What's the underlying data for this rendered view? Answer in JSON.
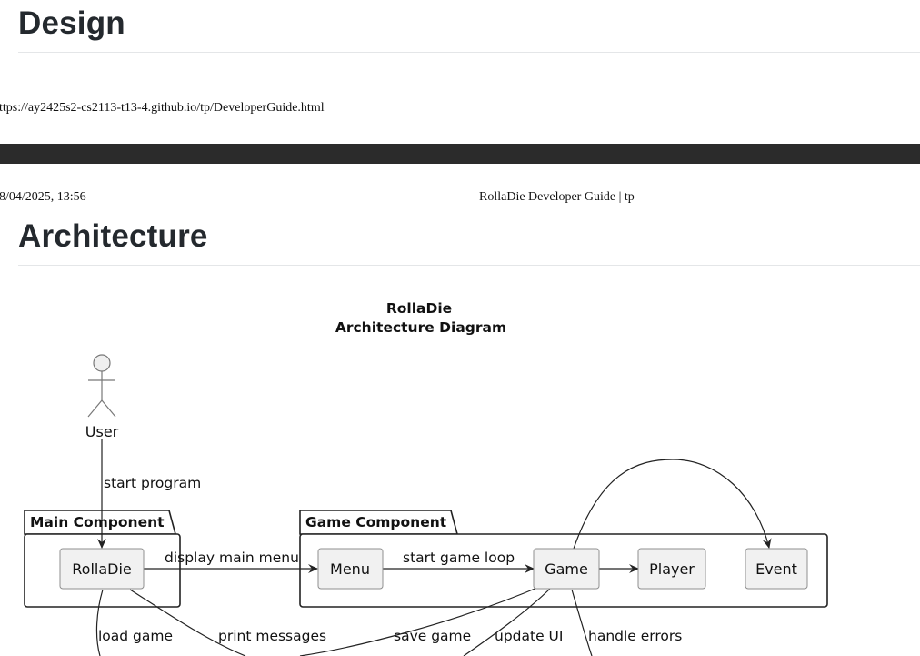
{
  "page": {
    "design_heading": "Design",
    "architecture_heading": "Architecture"
  },
  "print_header": {
    "url": "ttps://ay2425s2-cs2113-t13-4.github.io/tp/DeveloperGuide.html",
    "date": "8/04/2025, 13:56",
    "doc_title": "RollaDie Developer Guide | tp"
  },
  "diagram": {
    "title_line1": "RollaDie",
    "title_line2": "Architecture Diagram",
    "actor": "User",
    "packages": {
      "main": "Main Component",
      "game": "Game Component"
    },
    "nodes": {
      "rolladie": "RollaDie",
      "menu": "Menu",
      "game": "Game",
      "player": "Player",
      "event": "Event"
    },
    "edges": {
      "start_program": "start program",
      "display_main_menu": "display main menu",
      "start_game_loop": "start game loop",
      "load_game": "load game",
      "print_messages": "print messages",
      "save_game": "save game",
      "update_ui": "update UI",
      "handle_errors": "handle errors"
    }
  }
}
